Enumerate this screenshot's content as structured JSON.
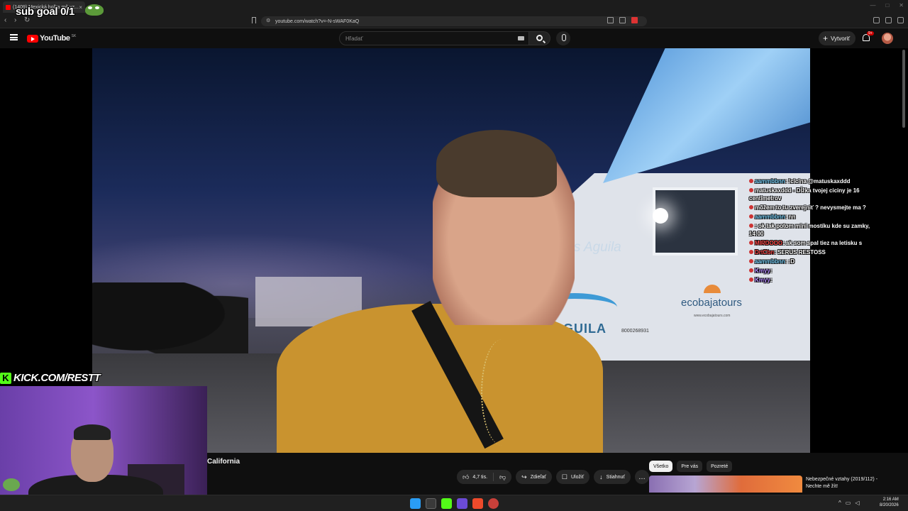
{
  "stream_overlay": {
    "sub_goal": "sub goal 0/1",
    "kick_url": "KICK.COM/RESTT",
    "kick_logo": "K"
  },
  "browser": {
    "tab_title": "(1409) Mexická holka mě vz...",
    "url": "youtube.com/watch?v=-N-sWAF0KaQ"
  },
  "youtube": {
    "logo_text": "YouTube",
    "country": "SK",
    "search_placeholder": "Hľadať",
    "create_label": "Vytvoriť",
    "notification_badge": "9+"
  },
  "video": {
    "title": "California",
    "scene_text": {
      "wall": "tes Aguila",
      "aguila": "AGUILA",
      "phone": "8000268931",
      "ecobaja": "ecobajatours",
      "ecobaja_url": "www.ecobajatours.com"
    }
  },
  "chat": [
    {
      "user": "aammbbnn",
      "user_color": "cyan",
      "text": ": !cicina @matuskaxddd"
    },
    {
      "user": "",
      "user_color": "cyan",
      "text": "matuskaxddd - Dĺžka tvojej ciciny je 16 centimetrov"
    },
    {
      "user": "",
      "user_color": "cyan",
      "text": "môžem to tu zverejniť ? nevysmejte ma ?"
    },
    {
      "user": "aammbbnn",
      "user_color": "cyan",
      "text": ": nn"
    },
    {
      "user": "",
      "user_color": "red",
      "text": ": ok tak potom mini mostíku kde su zamky, 14:00"
    },
    {
      "user": "MIRDOOO",
      "user_color": "red",
      "text": ": ak som spal tiez na letisku s"
    },
    {
      "user": "DrtCbn",
      "user_color": "red",
      "text": ": SERUS RESTOSS"
    },
    {
      "user": "aammbbnn",
      "user_color": "cyan",
      "text": ": :D"
    },
    {
      "user": "Kmyy",
      "user_color": "purple",
      "text": ":"
    },
    {
      "user": "Kmyy",
      "user_color": "purple",
      "text": ":"
    }
  ],
  "actions": {
    "likes": "4,7 tis.",
    "share": "Zdieľať",
    "save": "Uložiť",
    "download": "Stiahnuť",
    "more": "…"
  },
  "chips": [
    "Všetko",
    "Pre vás",
    "Pozreté"
  ],
  "recommendation": {
    "title": "Nebezpečné vztahy (2019/112) - Nechte mě žít!"
  },
  "taskbar": {
    "time": "2:16 AM",
    "date": "8/20/2026"
  },
  "colors": {
    "youtube_red": "#ff0000",
    "kick_green": "#53fc18",
    "background": "#0f0f0f"
  }
}
